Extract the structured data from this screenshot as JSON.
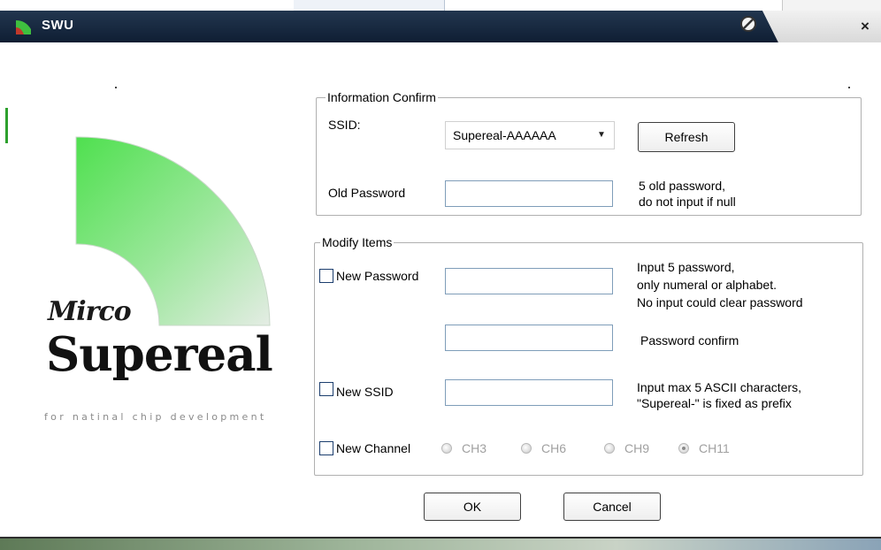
{
  "window": {
    "title": "SWU",
    "close_label": "×"
  },
  "logo": {
    "mirco": "Mirco",
    "brand": "Supereal",
    "tagline": "for natinal chip development"
  },
  "info_group": {
    "legend": "Information Confirm",
    "ssid_label": "SSID:",
    "ssid_selected": "Supereal-AAAAAA",
    "refresh_label": "Refresh",
    "old_password_label": "Old Password",
    "old_password_value": "",
    "old_password_hint_1": "5 old password,",
    "old_password_hint_2": "do not input if null"
  },
  "modify_group": {
    "legend": "Modify Items",
    "new_password_label": "New Password",
    "new_password_value": "",
    "new_password_hint_1": "Input 5 password,",
    "new_password_hint_2": "only numeral or alphabet.",
    "new_password_hint_3": "No input could clear password",
    "confirm_value": "",
    "confirm_hint": "Password confirm",
    "new_ssid_label": "New SSID",
    "new_ssid_value": "",
    "new_ssid_hint_1": "Input max 5 ASCII characters,",
    "new_ssid_hint_2": "\"Supereal-\" is fixed as prefix",
    "new_channel_label": "New Channel",
    "channels": [
      "CH3",
      "CH6",
      "CH9",
      "CH11"
    ],
    "selected_channel": "CH11"
  },
  "buttons": {
    "ok": "OK",
    "cancel": "Cancel"
  },
  "colors": {
    "titlebar": "#1a2b44",
    "logo_green": "#5fe05f"
  }
}
